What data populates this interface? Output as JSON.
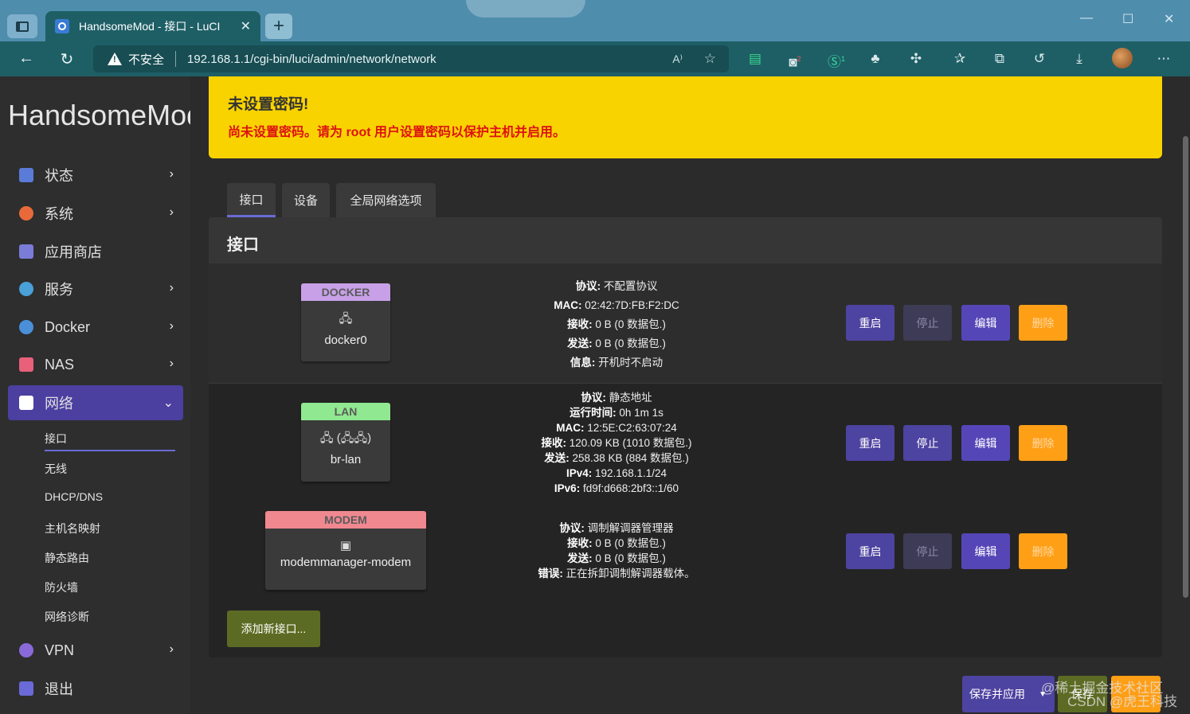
{
  "browser": {
    "tab_title": "HandsomeMod - 接口 - LuCI",
    "tab_close": "✕",
    "new_tab": "+",
    "win_min": "—",
    "win_max": "☐",
    "win_close": "✕",
    "security_label": "不安全",
    "url": "192.168.1.1/cgi-bin/luci/admin/network/network",
    "read_aloud": "A⁾",
    "ext_badge_1": "2",
    "ext_badge_2": "1"
  },
  "sidebar": {
    "brand": "HandsomeMod",
    "items": [
      {
        "label": "状态",
        "icon": "dashboard-icon",
        "color": "#5a7bd8"
      },
      {
        "label": "系统",
        "icon": "gear-icon",
        "color": "#e86a3a"
      },
      {
        "label": "应用商店",
        "icon": "cube-icon",
        "color": "#7b7bd8"
      },
      {
        "label": "服务",
        "icon": "cogs-icon",
        "color": "#4aa0d8"
      },
      {
        "label": "Docker",
        "icon": "docker-icon",
        "color": "#4a90d8"
      },
      {
        "label": "NAS",
        "icon": "database-icon",
        "color": "#e8607a"
      },
      {
        "label": "网络",
        "icon": "network-icon",
        "color": "#ffffff"
      },
      {
        "label": "VPN",
        "icon": "globe-icon",
        "color": "#8a6ad8"
      },
      {
        "label": "退出",
        "icon": "logout-cube-icon",
        "color": "#6a6ad8"
      }
    ],
    "sub_items": [
      "接口",
      "无线",
      "DHCP/DNS",
      "主机名映射",
      "静态路由",
      "防火墙",
      "网络诊断"
    ]
  },
  "alert": {
    "title": "未设置密码!",
    "message": "尚未设置密码。请为 root 用户设置密码以保护主机并启用。"
  },
  "tabs": [
    "接口",
    "设备",
    "全局网络选项"
  ],
  "panel_title": "接口",
  "interfaces": [
    {
      "name": "DOCKER",
      "label_color": "#c8a0e8",
      "device": "docker0",
      "icons": "🖧",
      "info": [
        {
          "k": "协议:",
          "v": " 不配置协议"
        },
        {
          "k": "MAC:",
          "v": " 02:42:7D:FB:F2:DC"
        },
        {
          "k": "接收:",
          "v": " 0 B (0 数据包.)"
        },
        {
          "k": "发送:",
          "v": " 0 B (0 数据包.)"
        },
        {
          "k": "信息:",
          "v": " 开机时不启动"
        }
      ]
    },
    {
      "name": "LAN",
      "label_color": "#90e890",
      "device": "br-lan",
      "icons": "🖧 (🖧🖧)",
      "info": [
        {
          "k": "协议:",
          "v": " 静态地址"
        },
        {
          "k": "运行时间:",
          "v": " 0h 1m 1s"
        },
        {
          "k": "MAC:",
          "v": " 12:5E:C2:63:07:24"
        },
        {
          "k": "接收:",
          "v": " 120.09 KB (1010 数据包.)"
        },
        {
          "k": "发送:",
          "v": " 258.38 KB (884 数据包.)"
        },
        {
          "k": "IPv4:",
          "v": " 192.168.1.1/24"
        },
        {
          "k": "IPv6:",
          "v": " fd9f:d668:2bf3::1/60"
        }
      ]
    },
    {
      "name": "MODEM",
      "label_color": "#f08890",
      "device": "modemmanager-modem",
      "icons": "▣",
      "info": [
        {
          "k": "协议:",
          "v": " 调制解调器管理器"
        },
        {
          "k": "接收:",
          "v": " 0 B (0 数据包.)"
        },
        {
          "k": "发送:",
          "v": " 0 B (0 数据包.)"
        },
        {
          "k": "错误:",
          "v": " 正在拆卸调制解调器载体。"
        }
      ]
    }
  ],
  "actions": {
    "restart": "重启",
    "stop": "停止",
    "edit": "编辑",
    "delete": "删除"
  },
  "add_interface": "添加新接口...",
  "footer": {
    "save_apply": "保存并应用",
    "save": "保存"
  },
  "watermark": {
    "line1": "@稀土掘金技术社区",
    "line2": "CSDN @虎王科技"
  }
}
